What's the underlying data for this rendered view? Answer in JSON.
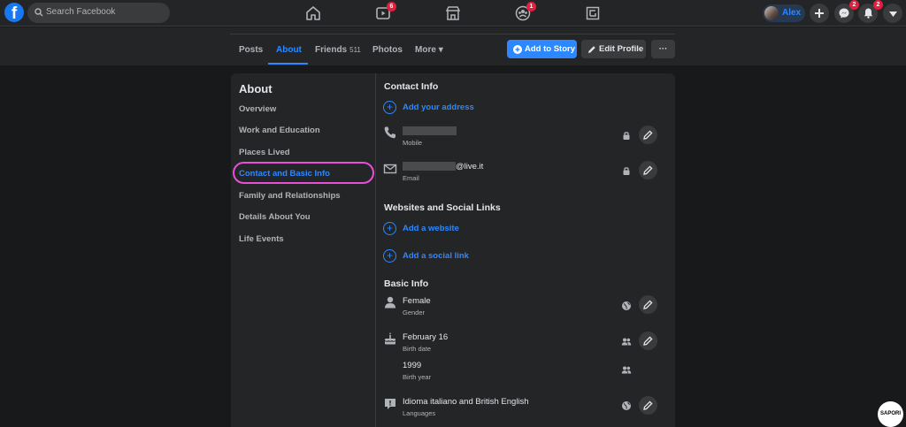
{
  "topbar": {
    "logo": "f",
    "search_placeholder": "Search Facebook",
    "badges": {
      "watch": "6",
      "groups": "1",
      "messenger": "2",
      "notifications": "2"
    },
    "user_name": "Alex"
  },
  "tabs": {
    "posts": "Posts",
    "about": "About",
    "friends": "Friends",
    "friends_count": "511",
    "photos": "Photos",
    "more": "More",
    "more_arrow": "▾",
    "add_story": "Add to Story",
    "edit_profile": "Edit Profile",
    "more_options": "···"
  },
  "about": {
    "title": "About",
    "nav": [
      "Overview",
      "Work and Education",
      "Places Lived",
      "Contact and Basic Info",
      "Family and Relationships",
      "Details About You",
      "Life Events"
    ],
    "active_index": 3
  },
  "contact": {
    "title": "Contact Info",
    "add_address": "Add your address",
    "mobile_label": "Mobile",
    "email_suffix": "@live.it",
    "email_label": "Email"
  },
  "websites": {
    "title": "Websites and Social Links",
    "add_website": "Add a website",
    "add_social": "Add a social link"
  },
  "basic": {
    "title": "Basic Info",
    "gender_value": "Female",
    "gender_label": "Gender",
    "birthdate_value": "February 16",
    "birthdate_label": "Birth date",
    "birthyear_value": "1999",
    "birthyear_label": "Birth year",
    "languages_value": "Idioma italiano and British English",
    "languages_label": "Languages"
  },
  "watermark": "SAPORI",
  "colors": {
    "accent": "#2d88ff",
    "background": "#18191a",
    "card": "#242526",
    "badge": "#e41e3f",
    "highlight": "#e64fd6"
  }
}
